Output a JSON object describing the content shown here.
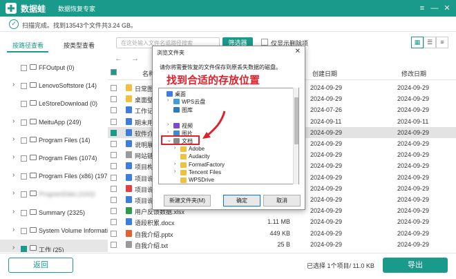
{
  "app": {
    "name": "数据蛙",
    "subtitle": "数据恢复专家",
    "colors": {
      "brand": "#1a9a8a",
      "annotation_red": "#e0202a"
    }
  },
  "window_controls": {
    "menu": "≡",
    "minimize": "—",
    "close": "✕"
  },
  "scan": {
    "icon": "check-circle-icon",
    "status": "扫描完成。找到13543个文件共3.24 GB。"
  },
  "view_tabs": {
    "path_label": "按路径查看",
    "type_label": "按类型查看"
  },
  "toolbar": {
    "search_placeholder": "在这处输入文件名或路径搜索",
    "filter_label": "筛选器",
    "show_deleted_label": "仅显示删除项"
  },
  "sidebar": {
    "items": [
      {
        "label": "FFOutput (0)",
        "expandable": false
      },
      {
        "label": "LenovoSoftstore (14)",
        "expandable": true
      },
      {
        "label": "LeStoreDownload (0)",
        "expandable": false
      },
      {
        "label": "MeituApp (249)",
        "expandable": true
      },
      {
        "label": "Program Files (14)",
        "expandable": true
      },
      {
        "label": "Program Files (1074)",
        "expandable": true
      },
      {
        "label": "Program Files (x86) (1976)",
        "expandable": true
      },
      {
        "label": "ProgramData (1163)",
        "expandable": true,
        "blurred": true
      },
      {
        "label": "Summary (2325)",
        "expandable": true
      },
      {
        "label": "System Volume Informati...",
        "expandable": true
      },
      {
        "label": "工作 (25)",
        "expandable": true,
        "selected": true
      }
    ]
  },
  "table": {
    "headers": {
      "name": "名称",
      "size": "大小",
      "created": "创建日期",
      "modified": "修改日期"
    },
    "rows": [
      {
        "name": "日常图库",
        "size": "",
        "created": "2024-09-29",
        "modified": "2024-09-29",
        "icon": "folder",
        "checked": false
      },
      {
        "name": "桌面壁纸",
        "size": "",
        "created": "2024-09-29",
        "modified": "2024-09-29",
        "icon": "folder",
        "checked": false
      },
      {
        "name": "工作记录1.xlsx",
        "size": "",
        "created": "2024-07-26",
        "modified": "2024-09-29",
        "icon": "doc",
        "checked": false
      },
      {
        "name": "期末用.pptx",
        "size": "",
        "created": "2024-09-11",
        "modified": "2024-09-11",
        "icon": "doc",
        "checked": false
      },
      {
        "name": "软件介绍.docx",
        "size": "",
        "created": "2024-09-29",
        "modified": "2024-09-29",
        "icon": "doc",
        "checked": true,
        "selected": true
      },
      {
        "name": "说明展示.pptx",
        "size": "",
        "created": "2024-09-29",
        "modified": "2024-09-29",
        "icon": "doc",
        "checked": false
      },
      {
        "name": "网站链接.txt",
        "size": "",
        "created": "2024-09-29",
        "modified": "2024-09-29",
        "icon": "txt",
        "checked": false
      },
      {
        "name": "项目构思.docx",
        "size": "",
        "created": "2024-09-29",
        "modified": "2024-09-29",
        "icon": "doc",
        "checked": false
      },
      {
        "name": "项目说明书.docx",
        "size": "",
        "created": "2024-09-29",
        "modified": "2024-09-29",
        "icon": "doc",
        "checked": false
      },
      {
        "name": "项目说明书.pdf",
        "size": "",
        "created": "2024-09-29",
        "modified": "2024-09-29",
        "icon": "pdf",
        "checked": false
      },
      {
        "name": "项目说明书.pptx",
        "size": "",
        "created": "2024-09-29",
        "modified": "2024-09-29",
        "icon": "doc",
        "checked": false
      },
      {
        "name": "用户反馈数据.xlsx",
        "size": "",
        "created": "2024-09-29",
        "modified": "2024-09-29",
        "icon": "xls",
        "checked": false
      },
      {
        "name": "语段积累.docx",
        "size": "1.11 MB",
        "created": "2024-09-29",
        "modified": "2024-09-29",
        "icon": "doc",
        "checked": false
      },
      {
        "name": "自我介绍.pptx",
        "size": "449 KB",
        "created": "2024-09-29",
        "modified": "2024-09-29",
        "icon": "ppt",
        "checked": false
      },
      {
        "name": "自我介绍.txt",
        "size": "25 B",
        "created": "2024-09-29",
        "modified": "2024-09-29",
        "icon": "txt",
        "checked": false
      }
    ]
  },
  "footer": {
    "back_label": "返回",
    "selection_info": "已选择 1个项目/ 11.0 KB",
    "export_label": "导出"
  },
  "dialog": {
    "title": "浏览文件夹",
    "description": "请你将需要恢复的文件保存到原丢失数据的磁盘。",
    "annotation": "找到合适的存放位置",
    "tree": [
      {
        "label": "桌面",
        "depth": 0,
        "arrow": "",
        "icon": "desktop"
      },
      {
        "label": "WPS云盘",
        "depth": 1,
        "arrow": "›",
        "icon": "cloud"
      },
      {
        "label": "图库",
        "depth": 1,
        "arrow": "",
        "icon": "gallery"
      },
      {
        "label": "",
        "depth": 1,
        "arrow": "",
        "icon": "blank"
      },
      {
        "label": "视频",
        "depth": 1,
        "arrow": "›",
        "icon": "video"
      },
      {
        "label": "图片",
        "depth": 1,
        "arrow": "›",
        "icon": "picture"
      },
      {
        "label": "文档",
        "depth": 1,
        "arrow": "⌄",
        "icon": "document"
      },
      {
        "label": "Adobe",
        "depth": 2,
        "arrow": "›",
        "icon": "folder"
      },
      {
        "label": "Audacity",
        "depth": 2,
        "arrow": "",
        "icon": "folder"
      },
      {
        "label": "FormatFactory",
        "depth": 2,
        "arrow": "›",
        "icon": "folder"
      },
      {
        "label": "Tencent Files",
        "depth": 2,
        "arrow": "›",
        "icon": "folder"
      },
      {
        "label": "WPSDrive",
        "depth": 2,
        "arrow": "",
        "icon": "folder"
      }
    ],
    "new_folder_label": "新建文件夹(M)",
    "ok_label": "确定",
    "cancel_label": "取消"
  }
}
